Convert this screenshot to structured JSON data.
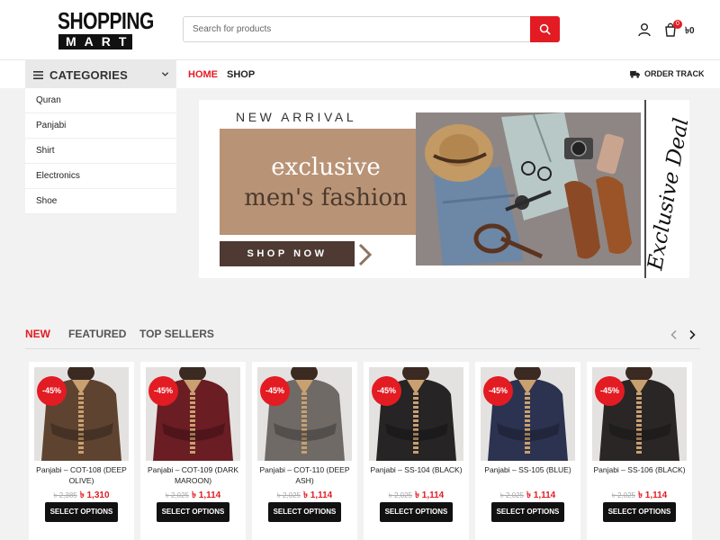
{
  "header": {
    "logo_top": "SHOPPING",
    "logo_bottom": "MART",
    "search_placeholder": "Search for products",
    "cart_count": "0",
    "cart_total": "৳0",
    "accent": "#e31b23"
  },
  "nav": {
    "categories_label": "CATEGORIES",
    "home": "HOME",
    "shop": "SHOP",
    "order_track": "ORDER TRACK"
  },
  "categories": [
    "Quran",
    "Panjabi",
    "Shirt",
    "Electronics",
    "Shoe"
  ],
  "banner": {
    "new_arrival": "NEW ARRIVAL",
    "line1": "exclusive",
    "line2": "men's fashion",
    "cta": "SHOP NOW",
    "script": "Exclusive Deal"
  },
  "tabs": [
    "NEW",
    "FEATURED",
    "TOP SELLERS"
  ],
  "products": [
    {
      "name": "Panjabi – COT-108 (DEEP OLIVE)",
      "discount": "-45%",
      "old_price": "৳ 2,385",
      "new_price": "৳ 1,310",
      "button": "SELECT OPTIONS",
      "color": "#5e4330"
    },
    {
      "name": "Panjabi – COT-109 (DARK MAROON)",
      "discount": "-45%",
      "old_price": "৳ 2,025",
      "new_price": "৳ 1,114",
      "button": "SELECT OPTIONS",
      "color": "#6b1d24"
    },
    {
      "name": "Panjabi – COT-110 (DEEP ASH)",
      "discount": "-45%",
      "old_price": "৳ 2,025",
      "new_price": "৳ 1,114",
      "button": "SELECT OPTIONS",
      "color": "#6f6a66"
    },
    {
      "name": "Panjabi – SS-104 (BLACK)",
      "discount": "-45%",
      "old_price": "৳ 2,025",
      "new_price": "৳ 1,114",
      "button": "SELECT OPTIONS",
      "color": "#262424"
    },
    {
      "name": "Panjabi – SS-105 (BLUE)",
      "discount": "-45%",
      "old_price": "৳ 2,025",
      "new_price": "৳ 1,114",
      "button": "SELECT OPTIONS",
      "color": "#2c3350"
    },
    {
      "name": "Panjabi – SS-106 (BLACK)",
      "discount": "-45%",
      "old_price": "৳ 2,025",
      "new_price": "৳ 1,114",
      "button": "SELECT OPTIONS",
      "color": "#2a2626"
    }
  ]
}
